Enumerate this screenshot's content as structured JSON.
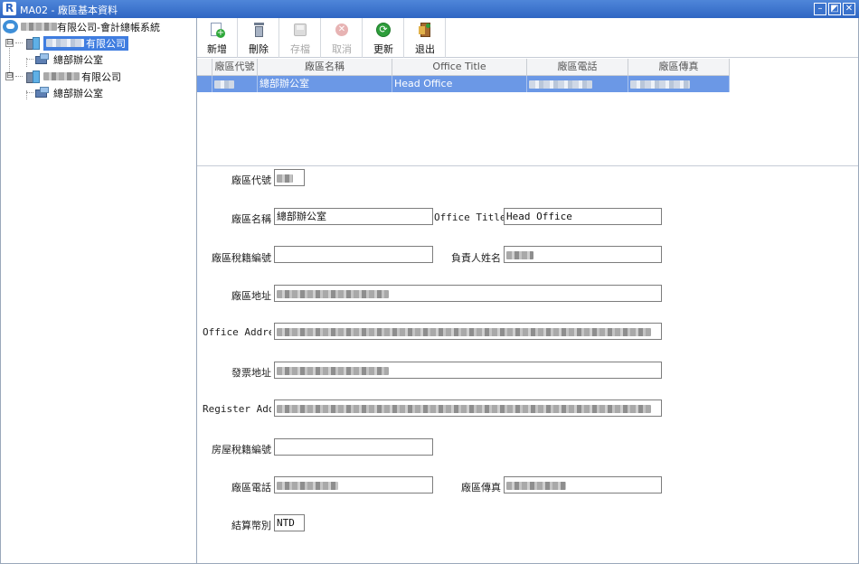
{
  "window": {
    "logo_letter": "R",
    "title": "MA02 - 廠區基本資料",
    "controls": {
      "minimize": "–",
      "restore": "◩",
      "close": "✕"
    }
  },
  "tree": {
    "root_label": "有限公司-會計總帳系統",
    "companies": [
      {
        "label": "有限公司",
        "expander": "⊟",
        "selected": true,
        "child_label": "總部辦公室"
      },
      {
        "label": "有限公司",
        "expander": "⊟",
        "selected": false,
        "child_label": "總部辦公室"
      }
    ]
  },
  "toolbar": {
    "buttons": [
      {
        "label": "新增",
        "icon": "add-icon",
        "enabled": true
      },
      {
        "label": "刪除",
        "icon": "delete-icon",
        "enabled": true
      },
      {
        "label": "存檔",
        "icon": "save-icon",
        "enabled": false
      },
      {
        "label": "取消",
        "icon": "cancel-icon",
        "enabled": false
      },
      {
        "label": "更新",
        "icon": "refresh-icon",
        "enabled": true
      },
      {
        "label": "退出",
        "icon": "exit-icon",
        "enabled": true
      }
    ]
  },
  "grid": {
    "columns": [
      "廠區代號",
      "廠區名稱",
      "Office Title",
      "廠區電話",
      "廠區傳真"
    ],
    "rows": [
      {
        "code": "",
        "name": "總部辦公室",
        "office_title": "Head Office",
        "phone": "",
        "fax": ""
      }
    ]
  },
  "form": {
    "code": {
      "label": "廠區代號",
      "value": ""
    },
    "name": {
      "label": "廠區名稱",
      "value": "總部辦公室"
    },
    "office_title": {
      "label": "Office Title",
      "value": "Head Office"
    },
    "tax_id": {
      "label": "廠區稅籍編號",
      "value": ""
    },
    "manager": {
      "label": "負責人姓名",
      "value": ""
    },
    "address": {
      "label": "廠區地址",
      "value": ""
    },
    "office_address": {
      "label": "Office Addres",
      "value": ""
    },
    "invoice_address": {
      "label": "發票地址",
      "value": ""
    },
    "register_address": {
      "label": "Register Addı",
      "value": ""
    },
    "house_tax_id": {
      "label": "房屋稅籍編號",
      "value": ""
    },
    "phone": {
      "label": "廠區電話",
      "value": ""
    },
    "fax": {
      "label": "廠區傳真",
      "value": ""
    },
    "currency": {
      "label": "結算幣別",
      "value": "NTD"
    }
  }
}
